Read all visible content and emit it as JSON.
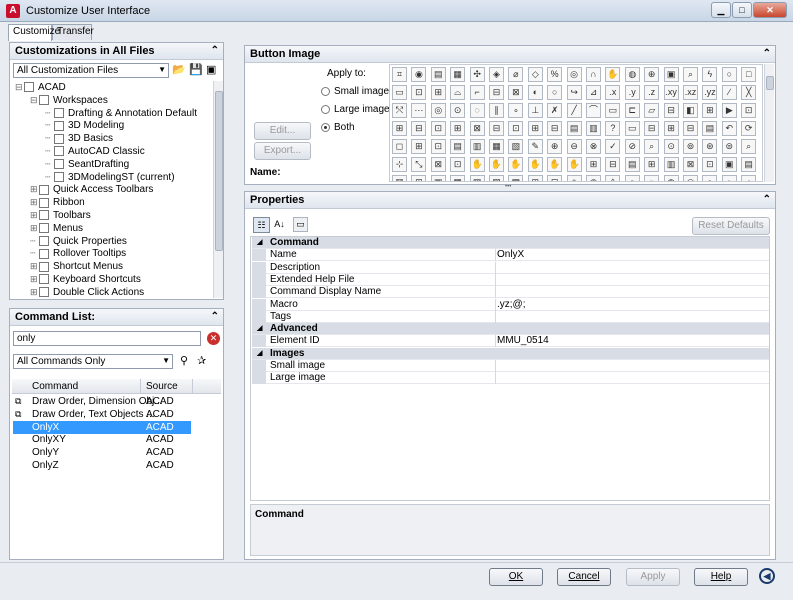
{
  "window": {
    "title": "Customize User Interface",
    "app_badge": "A"
  },
  "tabs": [
    {
      "label": "Customize"
    },
    {
      "label": "Transfer"
    }
  ],
  "left_top": {
    "header": "Customizations in All Files",
    "file_combo": "All Customization Files",
    "tree": [
      {
        "label": "ACAD",
        "depth": 0,
        "expander": "⊟"
      },
      {
        "label": "Workspaces",
        "depth": 1,
        "expander": "⊟"
      },
      {
        "label": "Drafting & Annotation Default",
        "depth": 2,
        "expander": ""
      },
      {
        "label": "3D Modeling",
        "depth": 2,
        "expander": ""
      },
      {
        "label": "3D Basics",
        "depth": 2,
        "expander": ""
      },
      {
        "label": "AutoCAD Classic",
        "depth": 2,
        "expander": ""
      },
      {
        "label": "SeantDrafting",
        "depth": 2,
        "expander": ""
      },
      {
        "label": "3DModelingST (current)",
        "depth": 2,
        "expander": ""
      },
      {
        "label": "Quick Access Toolbars",
        "depth": 1,
        "expander": "⊞"
      },
      {
        "label": "Ribbon",
        "depth": 1,
        "expander": "⊞"
      },
      {
        "label": "Toolbars",
        "depth": 1,
        "expander": "⊞"
      },
      {
        "label": "Menus",
        "depth": 1,
        "expander": "⊞"
      },
      {
        "label": "Quick Properties",
        "depth": 1,
        "expander": ""
      },
      {
        "label": "Rollover Tooltips",
        "depth": 1,
        "expander": ""
      },
      {
        "label": "Shortcut Menus",
        "depth": 1,
        "expander": "⊞"
      },
      {
        "label": "Keyboard Shortcuts",
        "depth": 1,
        "expander": "⊞"
      },
      {
        "label": "Double Click Actions",
        "depth": 1,
        "expander": "⊞"
      }
    ]
  },
  "command_list": {
    "header": "Command List:",
    "search_value": "only",
    "filter_combo": "All Commands Only",
    "columns": [
      "Command",
      "Source"
    ],
    "rows": [
      {
        "command": "Draw Order, Dimension Obj...",
        "source": "ACAD",
        "selected": false
      },
      {
        "command": "Draw Order, Text Objects ...",
        "source": "ACAD",
        "selected": false
      },
      {
        "command": "OnlyX",
        "source": "ACAD",
        "selected": true
      },
      {
        "command": "OnlyXY",
        "source": "ACAD",
        "selected": false
      },
      {
        "command": "OnlyY",
        "source": "ACAD",
        "selected": false
      },
      {
        "command": "OnlyZ",
        "source": "ACAD",
        "selected": false
      }
    ]
  },
  "button_image": {
    "header": "Button Image",
    "edit_label": "Edit...",
    "export_label": "Export...",
    "apply_to_label": "Apply to:",
    "options": [
      {
        "label": "Small image",
        "on": false
      },
      {
        "label": "Large image",
        "on": false
      },
      {
        "label": "Both",
        "on": true
      }
    ],
    "name_label": "Name:",
    "icon_glyphs": [
      "⌗",
      "◉",
      "▤",
      "▦",
      "✣",
      "◈",
      "⌀",
      "◇",
      "%",
      "◎",
      "∩",
      "✋",
      "◍",
      "⊕",
      "▣",
      "⌕",
      "ϟ",
      "○",
      "□",
      "▭",
      "⊡",
      "⊞",
      "⌓",
      "⌐",
      "⊟",
      "⊠",
      "◐",
      "○",
      "↪",
      "⊿",
      ".x",
      ".y",
      ".z",
      ".xy",
      ".xz",
      ".yz",
      "∕",
      "╳",
      "⤲",
      "⋯",
      "◎",
      "⊙",
      "◌",
      "∥",
      "∘",
      "⊥",
      "✗",
      "╱",
      "⌒",
      "▭",
      "⊏",
      "▱",
      "⊟",
      "◧",
      "⊞",
      "▶",
      "⊡",
      "⊞",
      "⊟",
      "⊡",
      "⊞",
      "⊠",
      "⊟",
      "⊡",
      "⊞",
      "⊟",
      "▤",
      "▥",
      "?",
      "▭",
      "⊟",
      "⊞",
      "⊟",
      "▤",
      "↶",
      "⟳",
      "◻",
      "⊞",
      "⊡",
      "▤",
      "▥",
      "▦",
      "▧",
      "✎",
      "⊕",
      "⊖",
      "⊗",
      "✓",
      "⊘",
      "⌕",
      "⊙",
      "⊚",
      "⊛",
      "⊜",
      "⌕",
      "⊹",
      "⤡",
      "⊠",
      "⊡",
      "✋",
      "✋",
      "✋",
      "✋",
      "✋",
      "✋",
      "⊞",
      "⊟",
      "▤",
      "⊞",
      "▥",
      "⊠",
      "⊡",
      "▣",
      "▤",
      "▥",
      "⊞",
      "▣",
      "▦",
      "▧",
      "▨",
      "▩",
      "⊞",
      "⊟",
      "◈",
      "◉",
      "◊",
      "○",
      "◌",
      "◍",
      "◎",
      "●",
      "◐",
      "◑",
      "◒",
      "◓",
      "◔",
      "◕",
      "☀",
      "◖"
    ]
  },
  "properties": {
    "header": "Properties",
    "reset_label": "Reset Defaults",
    "categories": [
      {
        "name": "Command",
        "rows": [
          {
            "key": "Name",
            "value": "OnlyX"
          },
          {
            "key": "Description",
            "value": ""
          },
          {
            "key": "Extended Help File",
            "value": ""
          },
          {
            "key": "Command Display Name",
            "value": ""
          },
          {
            "key": "Macro",
            "value": ".yz;@;"
          },
          {
            "key": "Tags",
            "value": ""
          }
        ]
      },
      {
        "name": "Advanced",
        "rows": [
          {
            "key": "Element ID",
            "value": "MMU_0514"
          }
        ]
      },
      {
        "name": "Images",
        "rows": [
          {
            "key": "Small image",
            "value": ""
          },
          {
            "key": "Large image",
            "value": ""
          }
        ]
      }
    ],
    "help_title": "Command"
  },
  "footer": {
    "ok": "OK",
    "cancel": "Cancel",
    "apply": "Apply",
    "help": "Help"
  }
}
